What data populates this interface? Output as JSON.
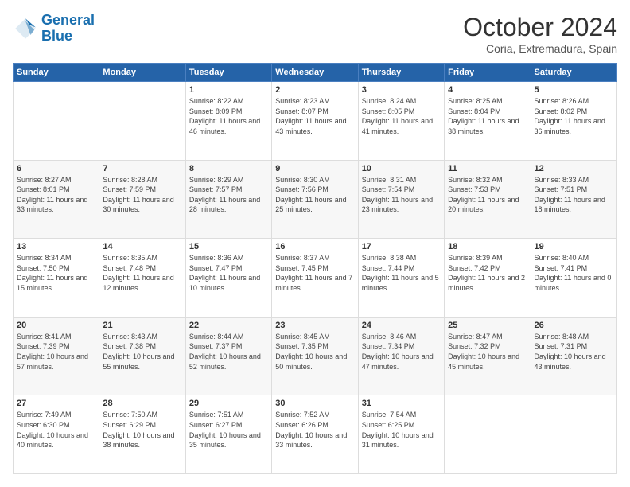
{
  "logo": {
    "line1": "General",
    "line2": "Blue"
  },
  "header": {
    "month": "October 2024",
    "location": "Coria, Extremadura, Spain"
  },
  "days_of_week": [
    "Sunday",
    "Monday",
    "Tuesday",
    "Wednesday",
    "Thursday",
    "Friday",
    "Saturday"
  ],
  "weeks": [
    [
      {
        "day": null
      },
      {
        "day": null
      },
      {
        "day": "1",
        "sunrise": "8:22 AM",
        "sunset": "8:09 PM",
        "daylight": "11 hours and 46 minutes."
      },
      {
        "day": "2",
        "sunrise": "8:23 AM",
        "sunset": "8:07 PM",
        "daylight": "11 hours and 43 minutes."
      },
      {
        "day": "3",
        "sunrise": "8:24 AM",
        "sunset": "8:05 PM",
        "daylight": "11 hours and 41 minutes."
      },
      {
        "day": "4",
        "sunrise": "8:25 AM",
        "sunset": "8:04 PM",
        "daylight": "11 hours and 38 minutes."
      },
      {
        "day": "5",
        "sunrise": "8:26 AM",
        "sunset": "8:02 PM",
        "daylight": "11 hours and 36 minutes."
      }
    ],
    [
      {
        "day": "6",
        "sunrise": "8:27 AM",
        "sunset": "8:01 PM",
        "daylight": "11 hours and 33 minutes."
      },
      {
        "day": "7",
        "sunrise": "8:28 AM",
        "sunset": "7:59 PM",
        "daylight": "11 hours and 30 minutes."
      },
      {
        "day": "8",
        "sunrise": "8:29 AM",
        "sunset": "7:57 PM",
        "daylight": "11 hours and 28 minutes."
      },
      {
        "day": "9",
        "sunrise": "8:30 AM",
        "sunset": "7:56 PM",
        "daylight": "11 hours and 25 minutes."
      },
      {
        "day": "10",
        "sunrise": "8:31 AM",
        "sunset": "7:54 PM",
        "daylight": "11 hours and 23 minutes."
      },
      {
        "day": "11",
        "sunrise": "8:32 AM",
        "sunset": "7:53 PM",
        "daylight": "11 hours and 20 minutes."
      },
      {
        "day": "12",
        "sunrise": "8:33 AM",
        "sunset": "7:51 PM",
        "daylight": "11 hours and 18 minutes."
      }
    ],
    [
      {
        "day": "13",
        "sunrise": "8:34 AM",
        "sunset": "7:50 PM",
        "daylight": "11 hours and 15 minutes."
      },
      {
        "day": "14",
        "sunrise": "8:35 AM",
        "sunset": "7:48 PM",
        "daylight": "11 hours and 12 minutes."
      },
      {
        "day": "15",
        "sunrise": "8:36 AM",
        "sunset": "7:47 PM",
        "daylight": "11 hours and 10 minutes."
      },
      {
        "day": "16",
        "sunrise": "8:37 AM",
        "sunset": "7:45 PM",
        "daylight": "11 hours and 7 minutes."
      },
      {
        "day": "17",
        "sunrise": "8:38 AM",
        "sunset": "7:44 PM",
        "daylight": "11 hours and 5 minutes."
      },
      {
        "day": "18",
        "sunrise": "8:39 AM",
        "sunset": "7:42 PM",
        "daylight": "11 hours and 2 minutes."
      },
      {
        "day": "19",
        "sunrise": "8:40 AM",
        "sunset": "7:41 PM",
        "daylight": "11 hours and 0 minutes."
      }
    ],
    [
      {
        "day": "20",
        "sunrise": "8:41 AM",
        "sunset": "7:39 PM",
        "daylight": "10 hours and 57 minutes."
      },
      {
        "day": "21",
        "sunrise": "8:43 AM",
        "sunset": "7:38 PM",
        "daylight": "10 hours and 55 minutes."
      },
      {
        "day": "22",
        "sunrise": "8:44 AM",
        "sunset": "7:37 PM",
        "daylight": "10 hours and 52 minutes."
      },
      {
        "day": "23",
        "sunrise": "8:45 AM",
        "sunset": "7:35 PM",
        "daylight": "10 hours and 50 minutes."
      },
      {
        "day": "24",
        "sunrise": "8:46 AM",
        "sunset": "7:34 PM",
        "daylight": "10 hours and 47 minutes."
      },
      {
        "day": "25",
        "sunrise": "8:47 AM",
        "sunset": "7:32 PM",
        "daylight": "10 hours and 45 minutes."
      },
      {
        "day": "26",
        "sunrise": "8:48 AM",
        "sunset": "7:31 PM",
        "daylight": "10 hours and 43 minutes."
      }
    ],
    [
      {
        "day": "27",
        "sunrise": "7:49 AM",
        "sunset": "6:30 PM",
        "daylight": "10 hours and 40 minutes."
      },
      {
        "day": "28",
        "sunrise": "7:50 AM",
        "sunset": "6:29 PM",
        "daylight": "10 hours and 38 minutes."
      },
      {
        "day": "29",
        "sunrise": "7:51 AM",
        "sunset": "6:27 PM",
        "daylight": "10 hours and 35 minutes."
      },
      {
        "day": "30",
        "sunrise": "7:52 AM",
        "sunset": "6:26 PM",
        "daylight": "10 hours and 33 minutes."
      },
      {
        "day": "31",
        "sunrise": "7:54 AM",
        "sunset": "6:25 PM",
        "daylight": "10 hours and 31 minutes."
      },
      {
        "day": null
      },
      {
        "day": null
      }
    ]
  ]
}
